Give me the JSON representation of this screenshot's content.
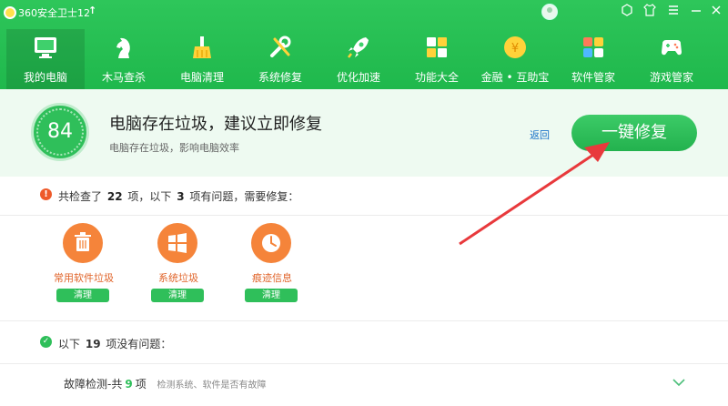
{
  "app": {
    "title": "360安全卫士12",
    "update_icon": "up-arrow-icon"
  },
  "window_controls": [
    "skin-icon",
    "shirt-icon",
    "menu-icon",
    "minimize-icon",
    "close-icon"
  ],
  "nav": [
    {
      "label": "我的电脑",
      "icon": "monitor-icon",
      "active": true
    },
    {
      "label": "木马查杀",
      "icon": "knight-icon"
    },
    {
      "label": "电脑清理",
      "icon": "broom-icon"
    },
    {
      "label": "系统修复",
      "icon": "wrench-icon"
    },
    {
      "label": "优化加速",
      "icon": "rocket-icon"
    },
    {
      "label": "功能大全",
      "icon": "grid-icon"
    },
    {
      "label": "金融 • 互助宝",
      "icon": "coin-icon"
    },
    {
      "label": "软件管家",
      "icon": "apps-icon"
    },
    {
      "label": "游戏管家",
      "icon": "gamepad-icon"
    }
  ],
  "summary": {
    "score": "84",
    "title": "电脑存在垃圾，建议立即修复",
    "subtitle": "电脑存在垃圾，影响电脑效率",
    "back": "返回",
    "fix_button": "一键修复"
  },
  "issues": {
    "prefix": "共检查了",
    "checked": "22",
    "middle": "项，以下",
    "problems": "3",
    "suffix": "项有问题，需要修复："
  },
  "cards": [
    {
      "label": "常用软件垃圾",
      "icon": "trash-icon",
      "button": "清理"
    },
    {
      "label": "系统垃圾",
      "icon": "windows-icon",
      "button": "清理"
    },
    {
      "label": "痕迹信息",
      "icon": "clock-icon",
      "button": "清理"
    }
  ],
  "ok": {
    "prefix": "以下",
    "count": "19",
    "suffix": "项没有问题："
  },
  "fault": {
    "label": "故障检测-共",
    "count": "9",
    "unit": "项",
    "desc": "检测系统、软件是否有故障"
  },
  "colors": {
    "brand_green": "#2fbf5a",
    "warn_orange": "#f5843a",
    "link_blue": "#1a73c9",
    "arrow_red": "#e8393c"
  }
}
